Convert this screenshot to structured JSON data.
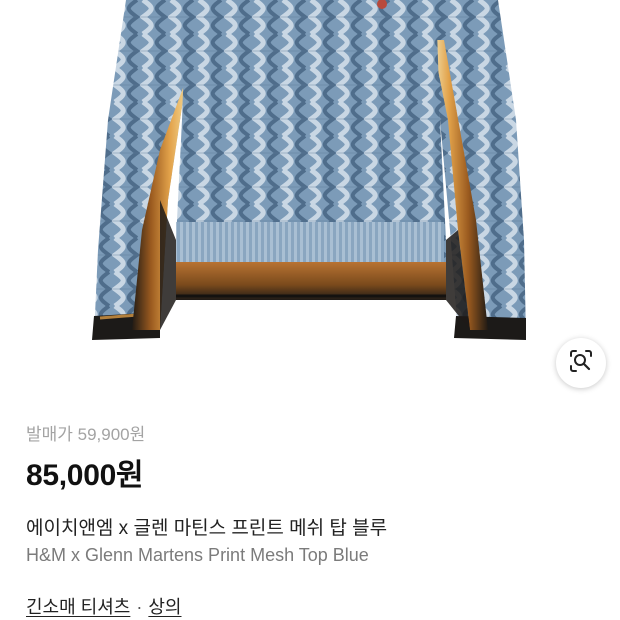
{
  "product": {
    "release_price": "발매가 59,900원",
    "price": "85,000원",
    "title_ko": "에이치앤엠 x 글렌 마틴스 프린트 메쉬 탑 블루",
    "title_en": "H&M x Glenn Martens Print Mesh Top Blue"
  },
  "category": {
    "primary": "긴소매 티셔츠",
    "separator": "·",
    "secondary": "상의"
  },
  "icons": {
    "image_search": "lens-search-icon"
  },
  "colors": {
    "price": "#111111",
    "release_price": "#a3a3a3",
    "subtitle": "#7b7b7b",
    "knit_blue": "#6f8fae",
    "flame_orange": "#c9802e"
  }
}
